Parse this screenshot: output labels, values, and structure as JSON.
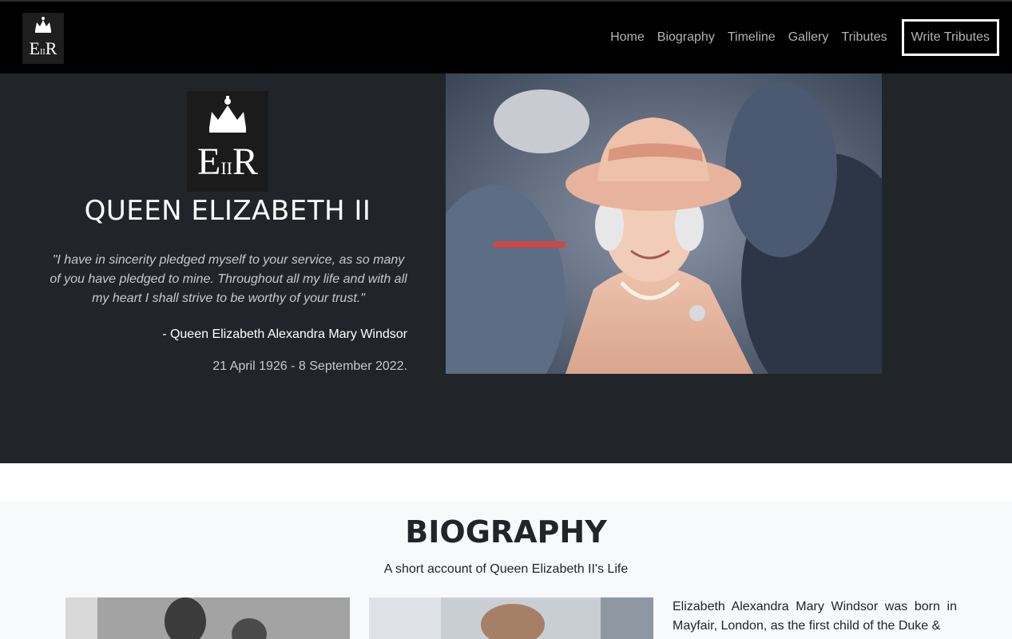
{
  "nav": {
    "logo_alt": "EIIR",
    "links": [
      "Home",
      "Biography",
      "Timeline",
      "Gallery",
      "Tributes"
    ],
    "cta": "Write Tributes"
  },
  "hero": {
    "emblem_letters": "EIIR",
    "title": "QUEEN ELIZABETH II",
    "quote": "\"I have in sincerity pledged myself to your service, as so many of you have pledged to mine. Throughout all my life and with all my heart I shall strive to be worthy of your trust.\"",
    "author": "- Queen Elizabeth Alexandra Mary Windsor",
    "dates": "21 April 1926 - 8 September 2022."
  },
  "biography": {
    "title": "BIOGRAPHY",
    "subtitle": "A short account of Queen Elizabeth II's Life",
    "text": "Elizabeth Alexandra Mary Windsor was born in Mayfair, London, as the first child of the Duke &"
  },
  "colors": {
    "navbar": "#000000",
    "hero_bg": "#212529",
    "bio_bg": "#f8f9fa",
    "coat_pink": "#e9b9a2"
  }
}
